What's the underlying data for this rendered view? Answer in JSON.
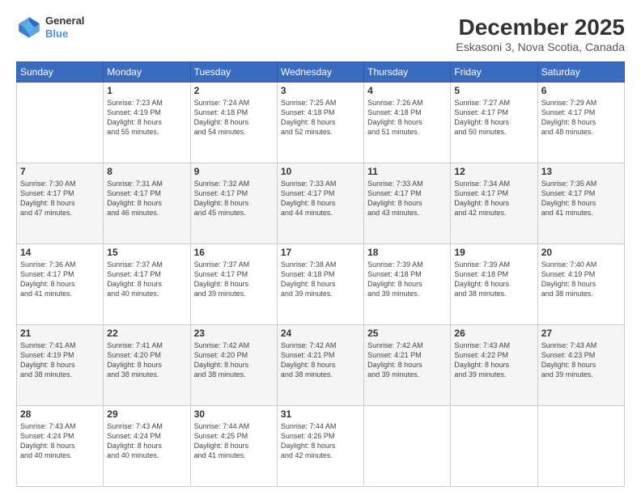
{
  "header": {
    "logo_line1": "General",
    "logo_line2": "Blue",
    "title": "December 2025",
    "subtitle": "Eskasoni 3, Nova Scotia, Canada"
  },
  "weekdays": [
    "Sunday",
    "Monday",
    "Tuesday",
    "Wednesday",
    "Thursday",
    "Friday",
    "Saturday"
  ],
  "weeks": [
    [
      {
        "day": "",
        "info": ""
      },
      {
        "day": "1",
        "info": "Sunrise: 7:23 AM\nSunset: 4:19 PM\nDaylight: 8 hours\nand 55 minutes."
      },
      {
        "day": "2",
        "info": "Sunrise: 7:24 AM\nSunset: 4:18 PM\nDaylight: 8 hours\nand 54 minutes."
      },
      {
        "day": "3",
        "info": "Sunrise: 7:25 AM\nSunset: 4:18 PM\nDaylight: 8 hours\nand 52 minutes."
      },
      {
        "day": "4",
        "info": "Sunrise: 7:26 AM\nSunset: 4:18 PM\nDaylight: 8 hours\nand 51 minutes."
      },
      {
        "day": "5",
        "info": "Sunrise: 7:27 AM\nSunset: 4:17 PM\nDaylight: 8 hours\nand 50 minutes."
      },
      {
        "day": "6",
        "info": "Sunrise: 7:29 AM\nSunset: 4:17 PM\nDaylight: 8 hours\nand 48 minutes."
      }
    ],
    [
      {
        "day": "7",
        "info": "Sunrise: 7:30 AM\nSunset: 4:17 PM\nDaylight: 8 hours\nand 47 minutes."
      },
      {
        "day": "8",
        "info": "Sunrise: 7:31 AM\nSunset: 4:17 PM\nDaylight: 8 hours\nand 46 minutes."
      },
      {
        "day": "9",
        "info": "Sunrise: 7:32 AM\nSunset: 4:17 PM\nDaylight: 8 hours\nand 45 minutes."
      },
      {
        "day": "10",
        "info": "Sunrise: 7:33 AM\nSunset: 4:17 PM\nDaylight: 8 hours\nand 44 minutes."
      },
      {
        "day": "11",
        "info": "Sunrise: 7:33 AM\nSunset: 4:17 PM\nDaylight: 8 hours\nand 43 minutes."
      },
      {
        "day": "12",
        "info": "Sunrise: 7:34 AM\nSunset: 4:17 PM\nDaylight: 8 hours\nand 42 minutes."
      },
      {
        "day": "13",
        "info": "Sunrise: 7:35 AM\nSunset: 4:17 PM\nDaylight: 8 hours\nand 41 minutes."
      }
    ],
    [
      {
        "day": "14",
        "info": "Sunrise: 7:36 AM\nSunset: 4:17 PM\nDaylight: 8 hours\nand 41 minutes."
      },
      {
        "day": "15",
        "info": "Sunrise: 7:37 AM\nSunset: 4:17 PM\nDaylight: 8 hours\nand 40 minutes."
      },
      {
        "day": "16",
        "info": "Sunrise: 7:37 AM\nSunset: 4:17 PM\nDaylight: 8 hours\nand 39 minutes."
      },
      {
        "day": "17",
        "info": "Sunrise: 7:38 AM\nSunset: 4:18 PM\nDaylight: 8 hours\nand 39 minutes."
      },
      {
        "day": "18",
        "info": "Sunrise: 7:39 AM\nSunset: 4:18 PM\nDaylight: 8 hours\nand 39 minutes."
      },
      {
        "day": "19",
        "info": "Sunrise: 7:39 AM\nSunset: 4:18 PM\nDaylight: 8 hours\nand 38 minutes."
      },
      {
        "day": "20",
        "info": "Sunrise: 7:40 AM\nSunset: 4:19 PM\nDaylight: 8 hours\nand 38 minutes."
      }
    ],
    [
      {
        "day": "21",
        "info": "Sunrise: 7:41 AM\nSunset: 4:19 PM\nDaylight: 8 hours\nand 38 minutes."
      },
      {
        "day": "22",
        "info": "Sunrise: 7:41 AM\nSunset: 4:20 PM\nDaylight: 8 hours\nand 38 minutes."
      },
      {
        "day": "23",
        "info": "Sunrise: 7:42 AM\nSunset: 4:20 PM\nDaylight: 8 hours\nand 38 minutes."
      },
      {
        "day": "24",
        "info": "Sunrise: 7:42 AM\nSunset: 4:21 PM\nDaylight: 8 hours\nand 38 minutes."
      },
      {
        "day": "25",
        "info": "Sunrise: 7:42 AM\nSunset: 4:21 PM\nDaylight: 8 hours\nand 39 minutes."
      },
      {
        "day": "26",
        "info": "Sunrise: 7:43 AM\nSunset: 4:22 PM\nDaylight: 8 hours\nand 39 minutes."
      },
      {
        "day": "27",
        "info": "Sunrise: 7:43 AM\nSunset: 4:23 PM\nDaylight: 8 hours\nand 39 minutes."
      }
    ],
    [
      {
        "day": "28",
        "info": "Sunrise: 7:43 AM\nSunset: 4:24 PM\nDaylight: 8 hours\nand 40 minutes."
      },
      {
        "day": "29",
        "info": "Sunrise: 7:43 AM\nSunset: 4:24 PM\nDaylight: 8 hours\nand 40 minutes."
      },
      {
        "day": "30",
        "info": "Sunrise: 7:44 AM\nSunset: 4:25 PM\nDaylight: 8 hours\nand 41 minutes."
      },
      {
        "day": "31",
        "info": "Sunrise: 7:44 AM\nSunset: 4:26 PM\nDaylight: 8 hours\nand 42 minutes."
      },
      {
        "day": "",
        "info": ""
      },
      {
        "day": "",
        "info": ""
      },
      {
        "day": "",
        "info": ""
      }
    ]
  ]
}
